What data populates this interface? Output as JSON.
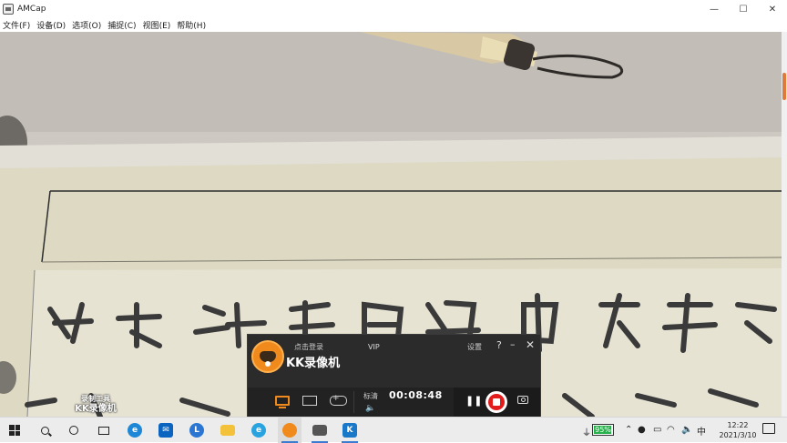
{
  "window": {
    "title": "AMCap",
    "controls": {
      "minimize": "—",
      "maximize": "☐",
      "close": "✕"
    }
  },
  "menu": [
    "文件(F)",
    "设备(D)",
    "选项(O)",
    "捕捉(C)",
    "视图(E)",
    "帮助(H)"
  ],
  "video": {
    "subject": "camera feed of calligraphy practice paper with a brush",
    "watermark": {
      "line1": "录制工具",
      "line2": "KK录像机"
    }
  },
  "kk_recorder": {
    "login": "点击登录",
    "vip": "VIP",
    "settings": "设置",
    "help": "?",
    "minimize": "–",
    "close": "✕",
    "app_name": "KK录像机",
    "quality": "标清",
    "elapsed": "00:08:48",
    "mode_active": "screen",
    "modes": [
      "screen",
      "window",
      "game"
    ],
    "recording": true
  },
  "taskbar": {
    "apps": [
      {
        "name": "edge",
        "color": "#1e88d6",
        "label": "e"
      },
      {
        "name": "mail",
        "color": "#0b64c0",
        "label": "✉"
      },
      {
        "name": "lync",
        "color": "#2a76d2",
        "label": "L"
      },
      {
        "name": "file-explorer",
        "color": "#f3c23a",
        "label": ""
      },
      {
        "name": "ie-like",
        "color": "#29a3e0",
        "label": "e"
      },
      {
        "name": "kk-recorder",
        "color": "#f18a1c",
        "label": ""
      },
      {
        "name": "amcap",
        "color": "#555555",
        "label": ""
      },
      {
        "name": "kk-app",
        "color": "#1a78c8",
        "label": "K"
      }
    ],
    "tray": {
      "battery": "95%",
      "battery_level": 0.95,
      "input_lang": "中",
      "time": "12:22",
      "date": "2021/3/10"
    }
  },
  "colors": {
    "kk_accent": "#f08a1e",
    "record_red": "#e31b1b",
    "scroll_thumb": "#e07a3a"
  }
}
